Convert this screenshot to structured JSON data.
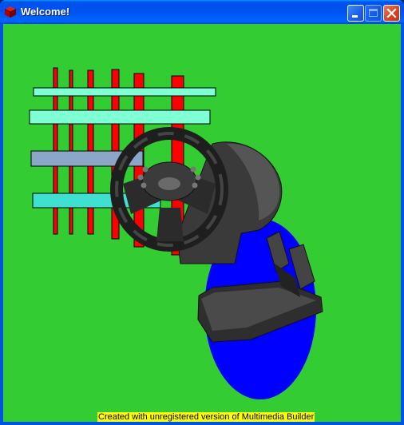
{
  "window": {
    "title": "Welcome!",
    "buttons": {
      "minimize": "minimize",
      "maximize": "maximize",
      "close": "close"
    }
  },
  "content": {
    "background_color": "#33cc33",
    "footer_text": "Created with unregistered version of Multimedia Builder"
  },
  "colors": {
    "red_bars": "#ff0000",
    "aqua_bar": "#7fffd4",
    "slate_bar": "#8ca6c8",
    "turquoise_bar": "#40e0d0",
    "blue_ellipse": "#0000ff",
    "footer_bg": "#ffff00"
  }
}
